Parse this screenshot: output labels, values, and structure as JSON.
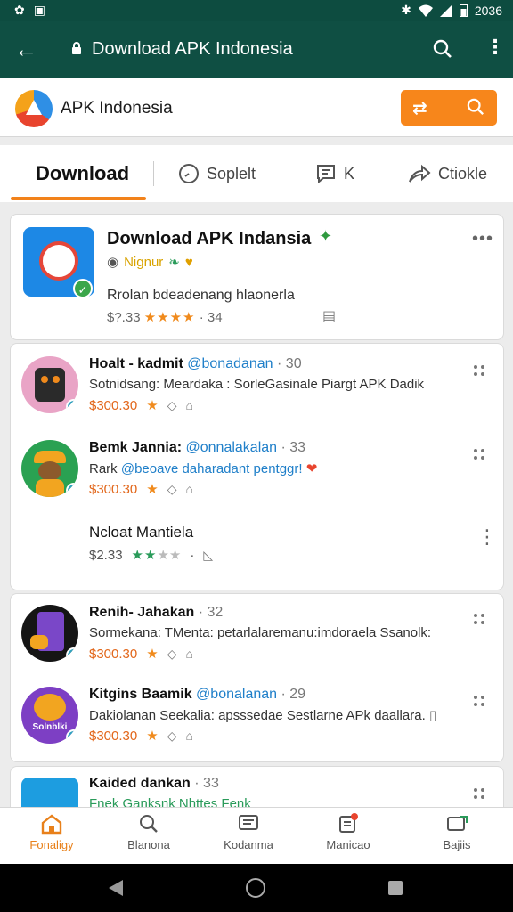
{
  "status": {
    "left_icons": [
      "flower-icon",
      "gallery-icon"
    ],
    "right_icons": [
      "bluetooth-icon",
      "wifi-icon",
      "signal-icon",
      "battery-icon"
    ],
    "time": "2036"
  },
  "appbar": {
    "title": "Download APK Indonesia",
    "back_icon": "arrow-left-icon",
    "search_icon": "search-icon",
    "more_icon": "more-vert-icon"
  },
  "brand": {
    "name": "APK Indonesia",
    "button_icons": [
      "shuffle-icon",
      "search-icon"
    ],
    "accent": "#f7861b"
  },
  "tabs": [
    {
      "label": "Download",
      "icon": ""
    },
    {
      "label": "Soplelt",
      "icon": "clock-icon"
    },
    {
      "label": "K",
      "icon": "message-icon"
    },
    {
      "label": "Ctiokle",
      "icon": "share-icon"
    }
  ],
  "featured": {
    "title": "Download APK Indansia",
    "meta_label": "Nignur",
    "description": "Rrolan bdeadenang hlaonerla",
    "price": "$?.33",
    "rating_text": "· 34",
    "stars": 4
  },
  "list1": [
    {
      "name": "Hoalt - kadmit",
      "handle": "@bonadanan",
      "num": "· 30",
      "text": "Sotnidsang: Meardaka : Sorle",
      "text_link": "Gasinale Piargt APK Dadik",
      "price": "$300.30",
      "stars": 1
    },
    {
      "name": "Bemk Jannia:",
      "handle": "@onnalakalan",
      "num": "· 33",
      "text": "Rark ",
      "text_link": "@beoave daharadant pentggr!",
      "price": "$300.30",
      "stars": 1
    },
    {
      "name": "Ncloat Mantiela",
      "handle": "",
      "num": "",
      "text": "",
      "text_link": "",
      "price": "$2.33",
      "stars": 2,
      "rating_tail": "· "
    }
  ],
  "list2": [
    {
      "name": "Renih- Jahakan",
      "handle": "",
      "num": "· 32",
      "text": "Sormekana: TMenta: petarlalaremanu:imdoraela Ssanolk:",
      "price": "$300.30",
      "stars": 1
    },
    {
      "name": "Kitgins Baamik",
      "handle": "@bonalanan",
      "num": "· 29",
      "text": "Dakiolanan Seekalia: apsssedae Sestlarne APk daallara.",
      "price": "$300.30",
      "stars": 1,
      "avatar_text": "Solnblki"
    },
    {
      "name": "Kaided dankan",
      "handle": "",
      "num": "· 33",
      "text": "Fnek Ganksnk Nhttes",
      "text_tail": "Fenk"
    }
  ],
  "bottom_nav": [
    {
      "label": "Fonaligy",
      "icon": "home-icon"
    },
    {
      "label": "Blanona",
      "icon": "search-icon"
    },
    {
      "label": "Kodanma",
      "icon": "chat-icon"
    },
    {
      "label": "Manicao",
      "icon": "notifications-icon"
    },
    {
      "label": "Bajiis",
      "icon": "apps-icon"
    }
  ]
}
